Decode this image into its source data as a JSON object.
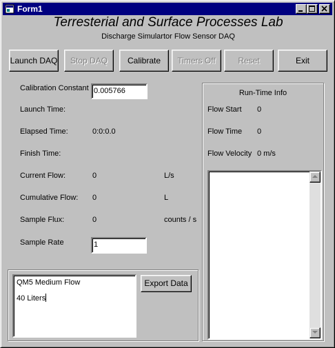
{
  "window": {
    "title": "Form1",
    "title_color": "#000080",
    "face_color": "#c0c0c0"
  },
  "header": {
    "title": "Terresterial and Surface Processes Lab",
    "subtitle": "Discharge Simulartor Flow Sensor DAQ"
  },
  "toolbar": {
    "launch": "Launch DAQ",
    "stop": "Stop DAQ",
    "calibrate": "Calibrate",
    "timers_off": "Timers Off",
    "reset": "Reset",
    "exit": "Exit"
  },
  "fields": {
    "calibration_constant": {
      "label": "Calibration Constant",
      "value": "0.005766"
    },
    "launch_time": {
      "label": "Launch Time:"
    },
    "elapsed_time": {
      "label": "Elapsed Time:",
      "value": "0:0:0.0"
    },
    "finish_time": {
      "label": "Finish Time:"
    },
    "current_flow": {
      "label": "Current Flow:",
      "value": "0",
      "unit": "L/s"
    },
    "cumulative_flow": {
      "label": "Cumulative Flow:",
      "value": "0",
      "unit": "L"
    },
    "sample_flux": {
      "label": "Sample Flux:",
      "value": "0",
      "unit": "counts / s"
    },
    "sample_rate": {
      "label": "Sample Rate",
      "value": "1"
    }
  },
  "notes": {
    "line1": "QM5 Medium Flow",
    "line2": "40 Liters",
    "export_label": "Export Data"
  },
  "runtime": {
    "title": "Run-Time Info",
    "flow_start": {
      "label": "Flow Start",
      "value": "0"
    },
    "flow_time": {
      "label": "Flow Time",
      "value": "0"
    },
    "flow_velocity": {
      "label": "Flow Velocity",
      "value": "0 m/s"
    }
  }
}
